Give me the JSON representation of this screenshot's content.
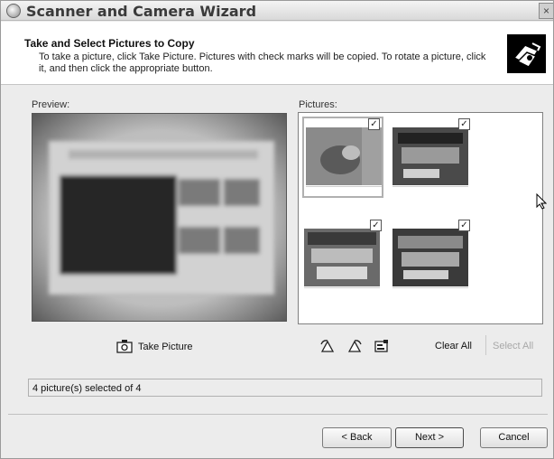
{
  "window": {
    "title": "Scanner and Camera Wizard"
  },
  "header": {
    "title": "Take and Select Pictures to Copy",
    "description": "To take a picture, click Take Picture. Pictures with check marks will be copied. To rotate a picture, click it, and then click the appropriate button."
  },
  "preview": {
    "label": "Preview:"
  },
  "pictures": {
    "label": "Pictures:",
    "items": [
      {
        "checked": true
      },
      {
        "checked": true
      },
      {
        "checked": true
      },
      {
        "checked": true
      }
    ]
  },
  "toolbar": {
    "take_picture_label": "Take Picture",
    "clear_all_label": "Clear All",
    "select_all_label": "Select All"
  },
  "status": {
    "text": "4 picture(s) selected of 4"
  },
  "buttons": {
    "back": "< Back",
    "next": "Next >",
    "cancel": "Cancel"
  }
}
